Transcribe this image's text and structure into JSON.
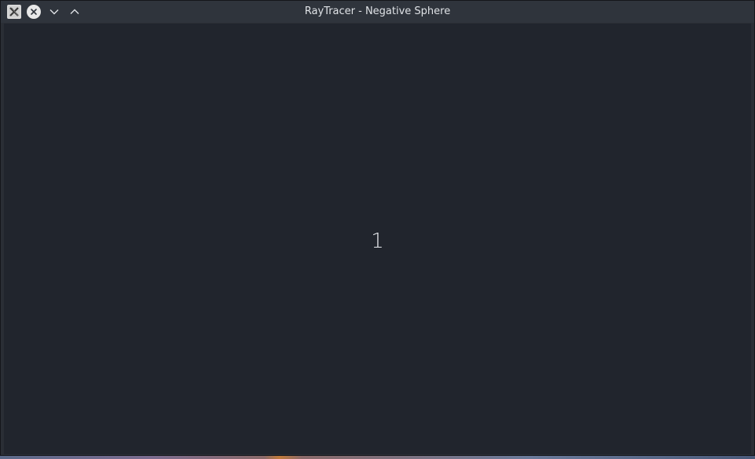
{
  "window": {
    "title": "RayTracer - Negative Sphere"
  },
  "titlebar": {
    "app_icon": "x11-app-icon",
    "close_icon": "close-icon",
    "minimize_icon": "chevron-down-icon",
    "maximize_icon": "chevron-up-icon"
  },
  "content": {
    "progress_label": "1"
  },
  "colors": {
    "titlebar": "#2f343c",
    "client_background": "#21252d",
    "title_text": "#dfe2e6"
  }
}
